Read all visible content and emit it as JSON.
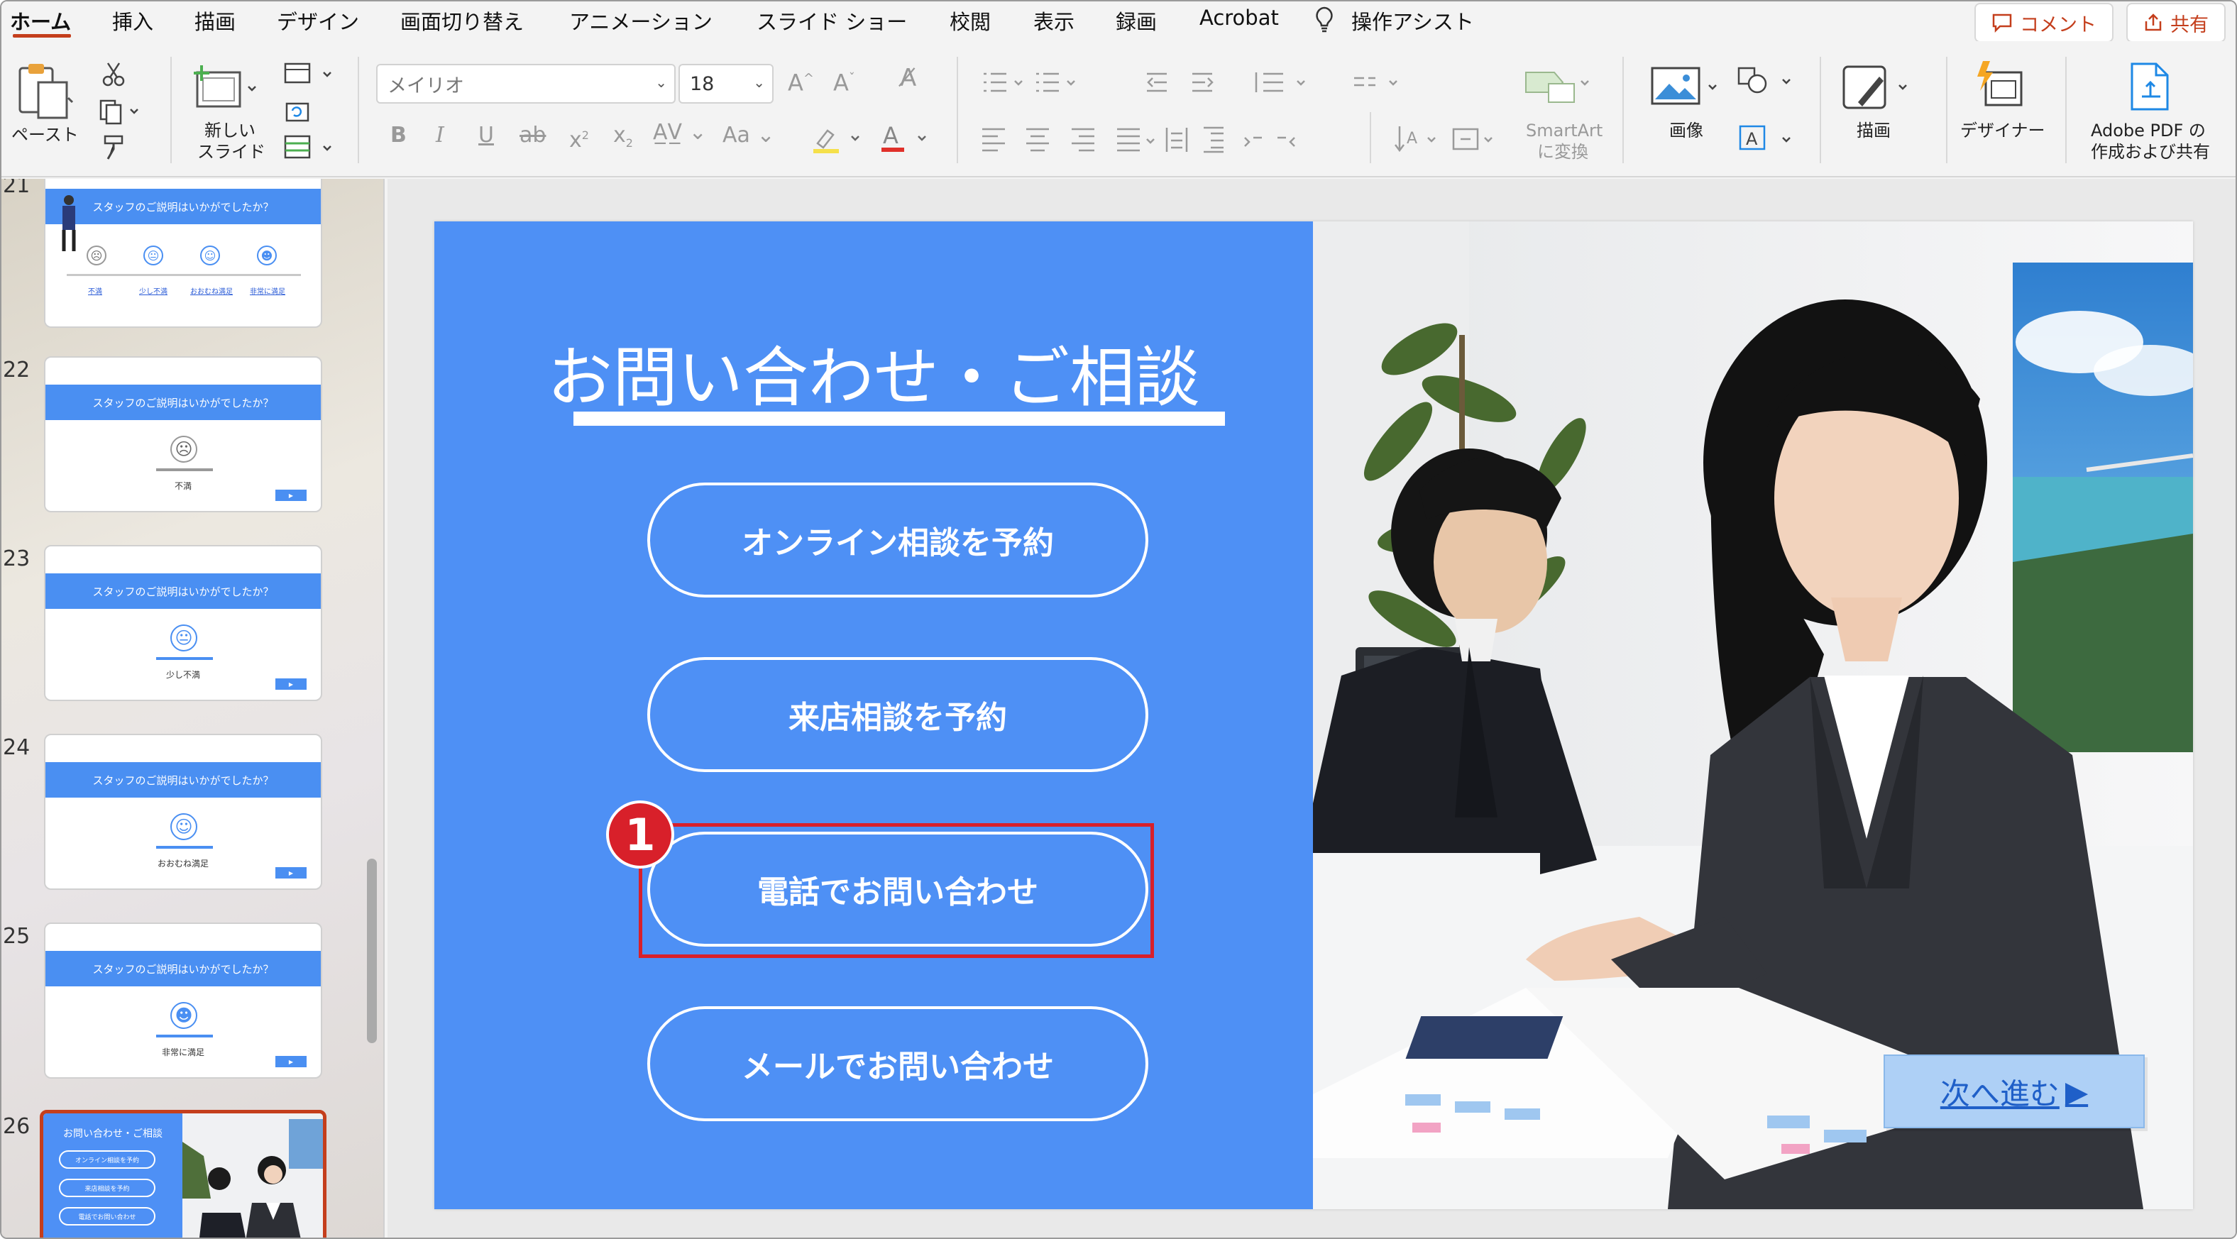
{
  "colors": {
    "accent": "#c43e1c",
    "slide_blue": "#4e90f5",
    "highlight_red": "#d8202a"
  },
  "tabs": [
    "ホーム",
    "挿入",
    "描画",
    "デザイン",
    "画面切り替え",
    "アニメーション",
    "スライド ショー",
    "校閲",
    "表示",
    "録画",
    "Acrobat",
    "操作アシスト"
  ],
  "topbar": {
    "comment_label": "コメント",
    "share_label": "共有"
  },
  "ribbon": {
    "paste_label": "ペースト",
    "new_slide_label_1": "新しい",
    "new_slide_label_2": "スライド",
    "font_name": "メイリオ",
    "font_size": "18",
    "smartart_label_1": "SmartArt",
    "smartart_label_2": "に変換",
    "image_label": "画像",
    "draw_label": "描画",
    "designer_label": "デザイナー",
    "adobe_label_1": "Adobe PDF の",
    "adobe_label_2": "作成および共有"
  },
  "sidebar": {
    "top_partial_number": "21",
    "thumb_21": {
      "title": "スタッフのご説明はいかがでしたか？",
      "options": [
        "不満",
        "少し不満",
        "おおむね満足",
        "非常に満足"
      ]
    },
    "thumbs": [
      {
        "number": "22",
        "title": "スタッフのご説明はいかがでしたか？",
        "caption": "不満",
        "face": "☹"
      },
      {
        "number": "23",
        "title": "スタッフのご説明はいかがでしたか？",
        "caption": "少し不満",
        "face": "😐"
      },
      {
        "number": "24",
        "title": "スタッフのご説明はいかがでしたか？",
        "caption": "おおむね満足",
        "face": "☺"
      },
      {
        "number": "25",
        "title": "スタッフのご説明はいかがでしたか？",
        "caption": "非常に満足",
        "face": "☻"
      }
    ],
    "thumb_26": {
      "number": "26",
      "title": "お問い合わせ・ご相談",
      "buttons": [
        "オンライン相談を予約",
        "来店相談を予約",
        "電話でお問い合わせ"
      ]
    }
  },
  "slide": {
    "title": "お問い合わせ・ご相談",
    "buttons": [
      "オンライン相談を予約",
      "来店相談を予約",
      "電話でお問い合わせ",
      "メールでお問い合わせ"
    ],
    "badge": "1",
    "next_button": "次へ進む",
    "next_arrow": "▶"
  }
}
